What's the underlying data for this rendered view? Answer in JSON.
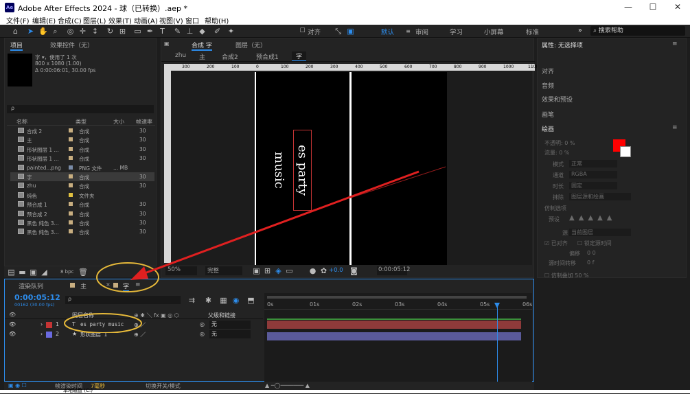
{
  "titlebar": {
    "title": "Adobe After Effects 2024 - 球（已转换）.aep *",
    "logo": "Ae",
    "min": "—",
    "max": "☐",
    "close": "✕"
  },
  "menu": [
    "文件(F)",
    "编辑(E)",
    "合成(C)",
    "图层(L)",
    "效果(T)",
    "动画(A)",
    "视图(V)",
    "窗口",
    "帮助(H)"
  ],
  "toolbar": {
    "align_label": "对齐",
    "workspaces": [
      "默认",
      "审阅",
      "学习",
      "小屏幕",
      "标准"
    ],
    "active_ws": "默认",
    "search_placeholder": "搜索帮助",
    "more": "»"
  },
  "project": {
    "tabs": [
      "项目",
      "效果控件（无）"
    ],
    "selected_name": "字 ▾，使用了 1 次",
    "selected_info1": "800 x 1080 (1.00)",
    "selected_info2": "Δ 0:00:06:01, 30.00 fps",
    "search_placeholder": "ρ",
    "columns": [
      "名称",
      "类型",
      "大小",
      "帧速率"
    ],
    "items": [
      {
        "name": "合成 2",
        "type": "合成",
        "size": "",
        "fps": "30",
        "color": "#c8ae80"
      },
      {
        "name": "主",
        "type": "合成",
        "size": "",
        "fps": "30",
        "color": "#c8ae80"
      },
      {
        "name": "形状图层 1 ...",
        "type": "合成",
        "size": "",
        "fps": "30",
        "color": "#c8ae80"
      },
      {
        "name": "形状图层 1 ...",
        "type": "合成",
        "size": "",
        "fps": "30",
        "color": "#c8ae80"
      },
      {
        "name": "painted...png",
        "type": "PNG 文件",
        "size": "... MB",
        "fps": "",
        "color": "#7a8ca8"
      },
      {
        "name": "字",
        "type": "合成",
        "size": "",
        "fps": "30",
        "color": "#c8ae80",
        "selected": true
      },
      {
        "name": "zhu",
        "type": "合成",
        "size": "",
        "fps": "30",
        "color": "#c8ae80"
      },
      {
        "name": "纯色",
        "type": "文件夹",
        "size": "",
        "fps": "",
        "color": "#e0c040"
      },
      {
        "name": "预合成 1",
        "type": "合成",
        "size": "",
        "fps": "30",
        "color": "#c8ae80"
      },
      {
        "name": "预合成 2",
        "type": "合成",
        "size": "",
        "fps": "30",
        "color": "#c8ae80"
      },
      {
        "name": "黑色 纯色 3...",
        "type": "合成",
        "size": "",
        "fps": "30",
        "color": "#c8ae80"
      },
      {
        "name": "黑色 纯色 3...",
        "type": "合成",
        "size": "",
        "fps": "30",
        "color": "#c8ae80"
      }
    ],
    "bpc": "8 bpc"
  },
  "comp": {
    "tabs": [
      "合成 字",
      "图层（无）"
    ],
    "breadcrumb": [
      "zhu",
      "主",
      "合成2",
      "预合成1",
      "字"
    ],
    "ruler": [
      "300",
      "200",
      "100",
      "0",
      "100",
      "200",
      "300",
      "400",
      "500",
      "600",
      "700",
      "800",
      "900",
      "1000",
      "1100"
    ],
    "text": "es party music",
    "zoom": "50%",
    "quality": "完整",
    "exposure": "+0.0",
    "timecode": "0:00:05:12"
  },
  "timeline": {
    "tabs": [
      "渲染队列",
      "主",
      "字"
    ],
    "timecode": "0:00:05:12",
    "frameinfo": "00162 (30.00 fps)",
    "search_placeholder": "ρ",
    "col_layer": "图层名称",
    "col_parent": "父级和链接",
    "ticks": [
      "0s",
      "01s",
      "02s",
      "03s",
      "04s",
      "05s",
      "06s"
    ],
    "current_fraction": 0.9,
    "layers": [
      {
        "num": "1",
        "type": "T",
        "name": "es party music",
        "parent": "无",
        "color": "#c43434",
        "bar": "#8e3a3a"
      },
      {
        "num": "2",
        "type": "★",
        "name": "形状图层 1",
        "parent": "无",
        "color": "#6a6ae0",
        "bar": "#5a5a9a"
      }
    ],
    "footer_render": "帧渲染时间",
    "footer_time": "7毫秒",
    "footer_switch": "切换开关/模式"
  },
  "properties": {
    "title": "属性: 无选择项",
    "sections": [
      "对齐",
      "音频",
      "效果和预设",
      "画笔",
      "绘画"
    ],
    "paint": {
      "opacity": "不透明: 0 %",
      "flow": "流量: 0 %",
      "mode_label": "模式",
      "mode": "正常",
      "channel_label": "通道",
      "channel": "RGBA",
      "duration_label": "时长",
      "duration": "固定",
      "erase_label": "抹除",
      "erase": "图层源和绘画",
      "clone": "仿制选项",
      "preset": "预设",
      "source_label": "源",
      "source": "当前图层",
      "aligned": "已对齐",
      "lock_time": "锁定源时间",
      "offset": "偏移",
      "offset_val": "0    0",
      "clone_time": "源时间转移",
      "clone_time_val": "0 f",
      "overlay": "仿制叠加",
      "overlay_val": "50 %",
      "fg": "#ff0000",
      "bg": "#ffffff"
    }
  },
  "taskbar": "本地磁盘 (C:)"
}
